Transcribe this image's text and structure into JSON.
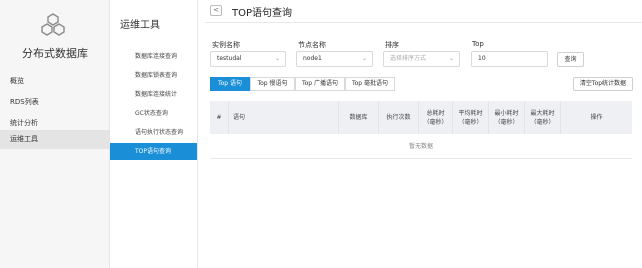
{
  "app": {
    "brand": "分布式数据库"
  },
  "nav_primary": [
    {
      "label": "概览"
    },
    {
      "label": "RDS列表"
    },
    {
      "label": "统计分析"
    },
    {
      "label": "运维工具",
      "active": true
    }
  ],
  "nav_secondary": {
    "title": "运维工具",
    "items": [
      {
        "label": "数据库连接查询"
      },
      {
        "label": "数据库锁表查询"
      },
      {
        "label": "数据库连接统计"
      },
      {
        "label": "GC状态查询"
      },
      {
        "label": "语句执行状态查询"
      },
      {
        "label": "TOP语句查询",
        "active": true
      }
    ]
  },
  "header": {
    "back_icon": "chevron-left-icon",
    "back_glyph": "<",
    "title": "TOP语句查询"
  },
  "filters": {
    "instance": {
      "label": "实例名称",
      "value": "testudal"
    },
    "node": {
      "label": "节点名称",
      "value": "node1"
    },
    "sort": {
      "label": "排序",
      "placeholder": "选择排序方式"
    },
    "top": {
      "label": "Top",
      "value": "10"
    },
    "query_button": "查询",
    "caret": "⌄"
  },
  "tabs": [
    {
      "label": "Top 语句",
      "active": true
    },
    {
      "label": "Top 慢语句"
    },
    {
      "label": "Top 广播语句"
    },
    {
      "label": "Top 毫批语句"
    }
  ],
  "clear_button": "清空Top统计数据",
  "table": {
    "columns": [
      "#",
      "语句",
      "数据库",
      "执行次数",
      "总耗时（毫秒）",
      "平均耗时（毫秒）",
      "最小耗时（毫秒）",
      "最大耗时（毫秒）",
      "操作"
    ],
    "empty_text": "暂无数据"
  },
  "colors": {
    "accent": "#1a8fd8",
    "sidebar_bg": "#f6f6f6",
    "header_bg": "#eef0f3"
  }
}
